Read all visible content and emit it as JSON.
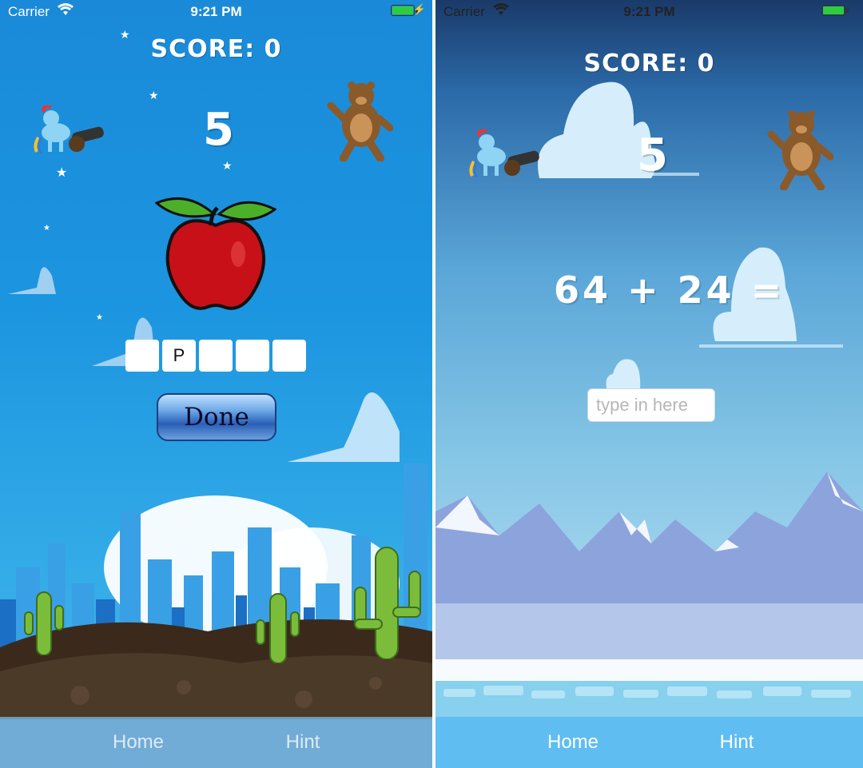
{
  "left_screen": {
    "status": {
      "carrier": "Carrier",
      "time": "9:21 PM"
    },
    "score_label": "SCORE: 0",
    "timer": "5",
    "letter_boxes": [
      "",
      "P",
      "",
      "",
      ""
    ],
    "done_label": "Done",
    "tabs": [
      {
        "label": "Home"
      },
      {
        "label": "Hint"
      }
    ],
    "icons": [
      "pony-cannon-icon",
      "bear-icon",
      "apple-image",
      "cactus-icon"
    ]
  },
  "right_screen": {
    "status": {
      "carrier": "Carrier",
      "time": "9:21 PM"
    },
    "score_label": "SCORE: 0",
    "timer": "5",
    "equation": "64 + 24 =",
    "answer_input": {
      "value": "",
      "placeholder": "type in here"
    },
    "tabs": [
      {
        "label": "Home"
      },
      {
        "label": "Hint"
      }
    ],
    "icons": [
      "pony-cannon-icon",
      "bear-icon",
      "mountain-scene"
    ]
  },
  "colors": {
    "battery": "#2ecc40",
    "left_sky": "#1c95e0",
    "right_tabbar": "#5fbdf2",
    "apple_red": "#c81018",
    "leaf_green": "#4caf2a"
  }
}
